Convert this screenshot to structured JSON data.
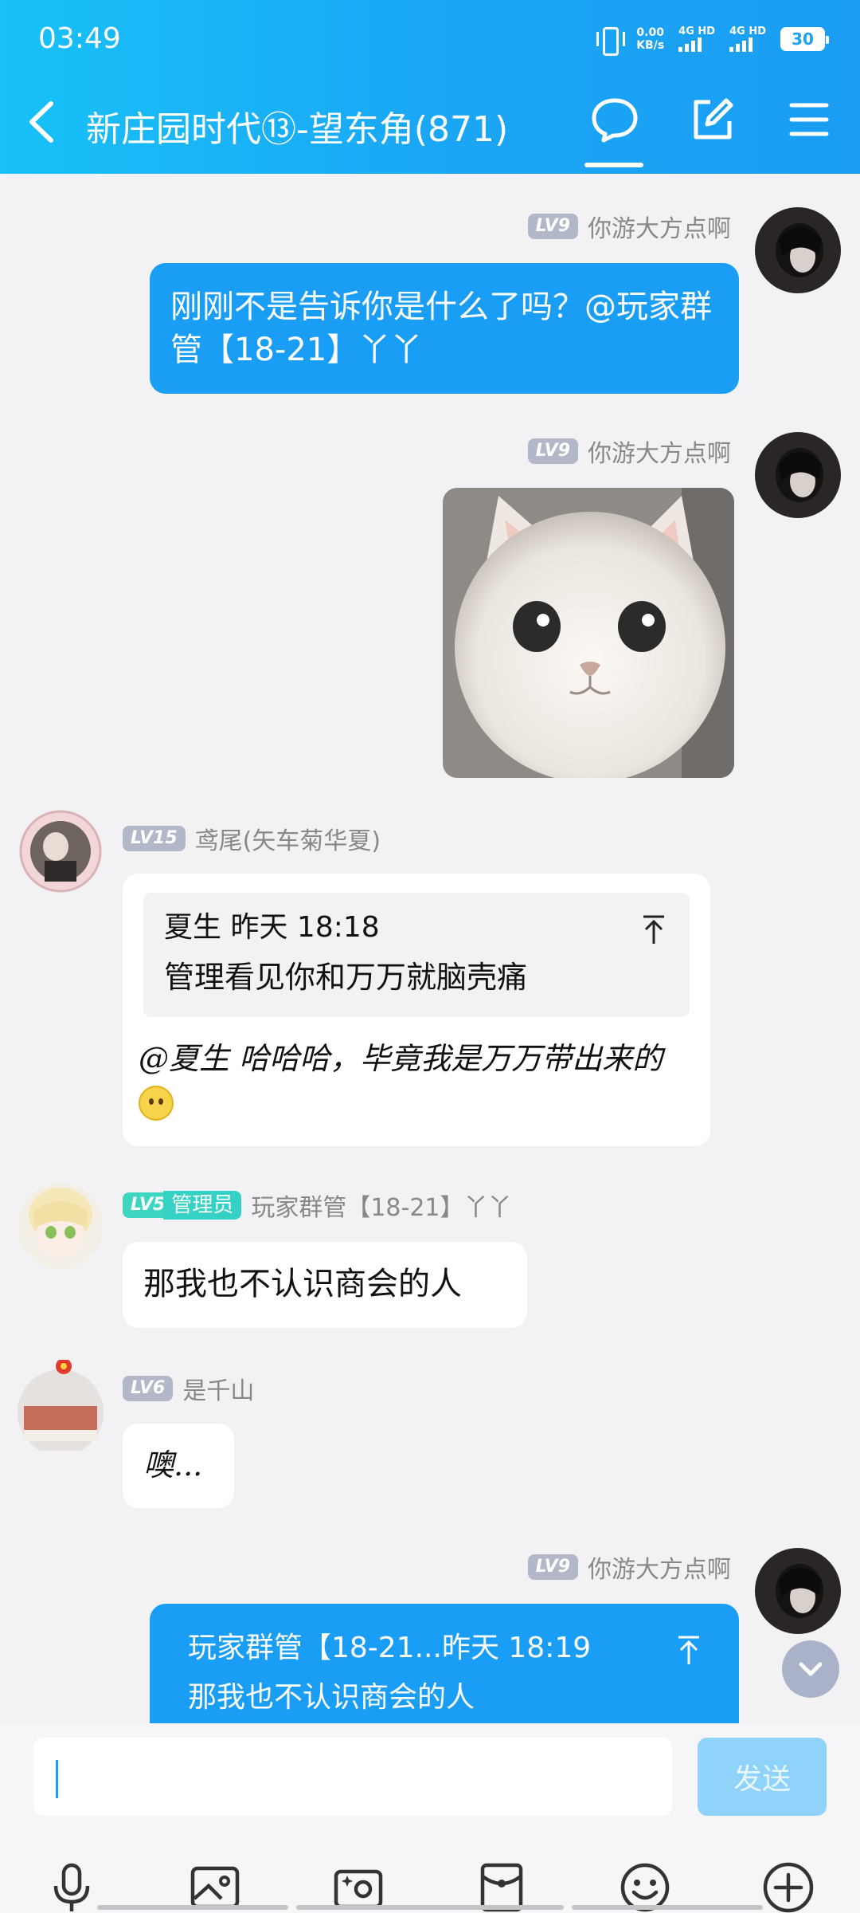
{
  "status_bar": {
    "time": "03:49",
    "net_speed_value": "0.00",
    "net_speed_unit": "KB/s",
    "signal1_label": "4G HD",
    "signal2_label": "4G HD",
    "battery": "30"
  },
  "header": {
    "title": "新庄园时代⑬-望东角(871)",
    "active_tab": "chat"
  },
  "messages": [
    {
      "sender": "你游大方点啊",
      "level": "LV9",
      "side": "right",
      "text": "刚刚不是告诉你是什么了吗？@玩家群管【18-21】丫丫"
    },
    {
      "sender": "你游大方点啊",
      "level": "LV9",
      "side": "right",
      "type": "sticker",
      "sticker_name": "white-cat-sticker"
    },
    {
      "sender": "鸢尾(矢车菊华夏)",
      "level": "LV15",
      "side": "left",
      "quote_author": "夏生",
      "quote_time": "昨天 18:18",
      "quote_text": "管理看见你和万万就脑壳痛",
      "text": "@夏生 哈哈哈，毕竟我是万万带出来的"
    },
    {
      "sender": "玩家群管【18-21】丫丫",
      "level": "LV5",
      "role": "管理员",
      "side": "left",
      "text": "那我也不认识商会的人"
    },
    {
      "sender": "是千山",
      "level": "LV6",
      "side": "left",
      "text": "噢..."
    },
    {
      "sender": "你游大方点啊",
      "level": "LV9",
      "side": "right",
      "quote_author": "玩家群管【18-21...",
      "quote_time": "昨天 18:19",
      "quote_text": "那我也不认识商会的人"
    }
  ],
  "composer": {
    "placeholder": "",
    "send_label": "发送"
  },
  "colors": {
    "header_gradient_start": "#18c1f7",
    "header_gradient_end": "#1a9df3",
    "bubble_blue": "#1a9ef5",
    "admin_badge": "#34d1c4",
    "level_badge": "#b3b8c8"
  },
  "toolbar_icons": [
    "microphone-icon",
    "image-icon",
    "camera-icon",
    "red-packet-icon",
    "emoji-icon",
    "plus-icon"
  ]
}
